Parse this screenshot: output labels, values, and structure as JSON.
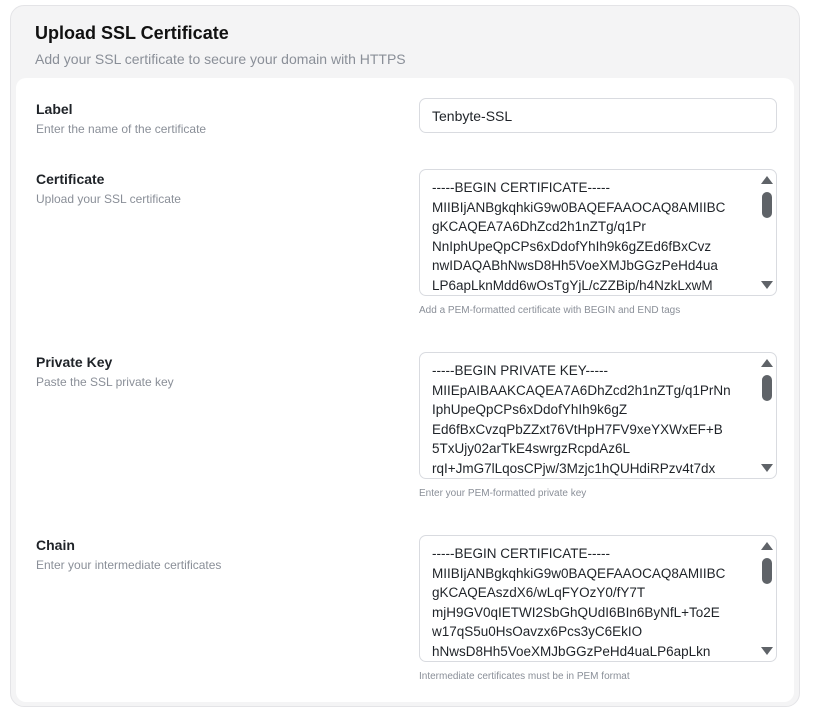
{
  "header": {
    "title": "Upload SSL Certificate",
    "subtitle": "Add your SSL certificate to secure your domain with HTTPS"
  },
  "fields": {
    "label": {
      "title": "Label",
      "help": "Enter the name of the certificate",
      "value": "Tenbyte-SSL"
    },
    "certificate": {
      "title": "Certificate",
      "help": "Upload your SSL certificate",
      "lines": [
        "-----BEGIN CERTIFICATE-----",
        "MIIBIjANBgkqhkiG9w0BAQEFAAOCAQ8AMIIBC",
        "gKCAQEA7A6DhZcd2h1nZTg/q1Pr",
        "NnIphUpeQpCPs6xDdofYhIh9k6gZEd6fBxCvz",
        "nwIDAQABhNwsD8Hh5VoeXMJbGGzPeHd4ua",
        "LP6apLknMdd6wOsTgYjL/cZZBip/h4NzkLxwM"
      ],
      "note": "Add a PEM-formatted certificate with BEGIN and END tags"
    },
    "private_key": {
      "title": "Private Key",
      "help": "Paste the SSL private key",
      "lines": [
        "-----BEGIN PRIVATE KEY-----",
        "MIIEpAIBAAKCAQEA7A6DhZcd2h1nZTg/q1PrNn",
        "IphUpeQpCPs6xDdofYhIh9k6gZ",
        "Ed6fBxCvzqPbZZxt76VtHpH7FV9xeYXWxEF+B",
        "5TxUjy02arTkE4swrgzRcpdAz6L",
        "rqI+JmG7lLqosCPjw/3Mzjc1hQUHdiRPzv4t7dx"
      ],
      "note": "Enter your PEM-formatted private key"
    },
    "chain": {
      "title": "Chain",
      "help": "Enter your intermediate certificates",
      "lines": [
        "-----BEGIN CERTIFICATE-----",
        "MIIBIjANBgkqhkiG9w0BAQEFAAOCAQ8AMIIBC",
        "gKCAQEAszdX6/wLqFYOzY0/fY7T",
        "mjH9GV0qIETWI2SbGhQUdI6BIn6ByNfL+To2E",
        "w17qS5u0HsOavzx6Pcs3yC6EkIO",
        "hNwsD8Hh5VoeXMJbGGzPeHd4uaLP6apLkn"
      ],
      "note": "Intermediate certificates must be in PEM format"
    }
  }
}
